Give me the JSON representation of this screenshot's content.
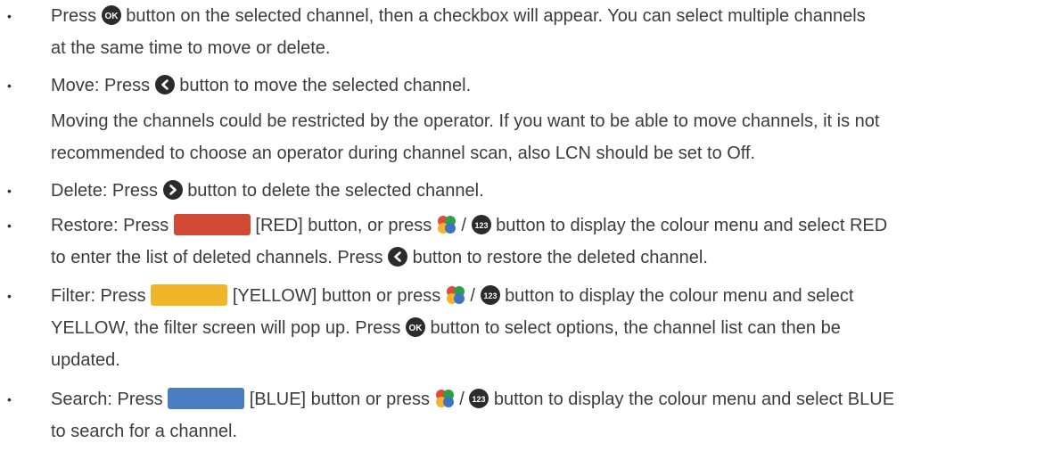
{
  "colors": {
    "icon": "#2b2b2b",
    "red": "#d04a35",
    "yellow": "#f1b52a",
    "blue": "#4a7cc1"
  },
  "icons": {
    "ok": "ok-icon",
    "left": "left-arrow-icon",
    "right": "right-arrow-icon",
    "colour": "colour-menu-icon",
    "num": "number-123-icon"
  },
  "items": [
    {
      "a": "Press",
      "b": "button on the selected channel, then a checkbox will appear. You can select multiple channels",
      "c": "at the same time to move or delete."
    },
    {
      "a": "Move: Press",
      "b": "button to move the selected channel."
    },
    {
      "p1": "Moving the channels could be restricted by the operator. If you want to be able to move channels, it is not",
      "p2": "recommended to choose an operator during channel scan, also LCN should be set to Off."
    },
    {
      "a": "Delete: Press",
      "b": "button to delete the selected channel."
    },
    {
      "a": "Restore: Press",
      "b": "[RED] button, or press",
      "sep": "/",
      "c": "button to display the colour menu and select RED",
      "d": "to enter the list of deleted channels. Press",
      "e": "button to restore the deleted channel."
    },
    {
      "a": "Filter: Press",
      "b": "[YELLOW] button or press",
      "sep": "/",
      "c": "button to display the colour menu and select",
      "d": "YELLOW, the filter screen will pop up. Press",
      "e": "button to select options, the channel list can then be",
      "f": "updated."
    },
    {
      "a": "Search: Press",
      "b": "[BLUE] button or press",
      "sep": "/",
      "c": "button to display the colour menu and select BLUE",
      "d": "to search for a channel."
    }
  ],
  "bullet": "•"
}
